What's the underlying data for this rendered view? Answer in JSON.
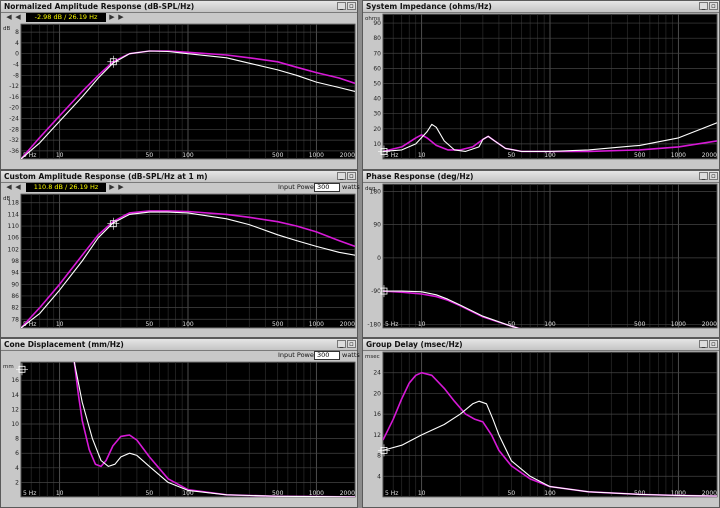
{
  "panels": [
    {
      "title": "Normalized Amplitude Response (dB-SPL/Hz)",
      "readout": "-2.98 dB / 26.19 Hz",
      "chart_data": {
        "type": "line",
        "xscale": "log",
        "xlim": [
          5,
          2000
        ],
        "ylim": [
          -39,
          11
        ],
        "yticks": [
          8,
          4,
          0,
          -4,
          -8,
          -12,
          -16,
          -20,
          -24,
          -28,
          -32,
          -36
        ],
        "yunit": "dB",
        "xticks": [
          "5 Hz",
          "10",
          "50",
          "100",
          "500",
          "1000",
          "2000"
        ],
        "cursor": {
          "x": 26.19,
          "y": -2.98
        },
        "series": [
          {
            "color": "#d619d6",
            "x": [
              5,
              7,
              10,
              15,
              20,
              26,
              35,
              50,
              70,
              100,
              200,
              300,
              500,
              700,
              1000,
              1500,
              2000
            ],
            "y": [
              -39,
              -31,
              -23,
              -14,
              -8,
              -3,
              0,
              1,
              1,
              0.5,
              -0.5,
              -1.5,
              -3,
              -5,
              -7,
              -9,
              -11
            ]
          },
          {
            "color": "#ffffff",
            "x": [
              5,
              7,
              10,
              15,
              20,
              26,
              35,
              50,
              70,
              100,
              200,
              300,
              500,
              700,
              1000,
              1500,
              2000
            ],
            "y": [
              -39,
              -33,
              -25,
              -16,
              -9,
              -3.5,
              0,
              1,
              0.8,
              0,
              -1.5,
              -3.5,
              -6,
              -8,
              -10.5,
              -12.5,
              -14
            ]
          }
        ]
      }
    },
    {
      "title": "System Impedance (ohms/Hz)",
      "chart_data": {
        "type": "line",
        "xscale": "log",
        "xlim": [
          5,
          2000
        ],
        "ylim": [
          0,
          96
        ],
        "yticks": [
          90,
          80,
          70,
          60,
          50,
          40,
          30,
          20,
          10
        ],
        "yunit": "ohms",
        "xticks": [
          "5 Hz",
          "10",
          "50",
          "100",
          "500",
          "1000",
          "2000"
        ],
        "cursor": {
          "x": 5,
          "y": 5
        },
        "series": [
          {
            "color": "#d619d6",
            "x": [
              5,
              7,
              9,
              10,
              11,
              13,
              16,
              20,
              25,
              30,
              33,
              37,
              45,
              60,
              100,
              200,
              500,
              1000,
              2000
            ],
            "y": [
              5,
              8,
              14,
              16,
              14,
              9,
              6,
              6,
              8,
              13,
              15,
              12,
              7,
              5,
              5,
              5,
              6,
              8,
              12
            ]
          },
          {
            "color": "#ffffff",
            "x": [
              5,
              7,
              9,
              11,
              12,
              13,
              15,
              18,
              22,
              28,
              30,
              33,
              37,
              45,
              60,
              100,
              200,
              500,
              1000,
              2000
            ],
            "y": [
              5,
              6,
              10,
              18,
              23,
              21,
              12,
              6,
              5,
              8,
              13,
              15,
              12,
              7,
              5,
              5,
              6,
              9,
              14,
              24
            ]
          }
        ]
      }
    },
    {
      "title": "Custom Amplitude Response (dB-SPL/Hz at 1 m)",
      "readout": "110.8 dB / 26.19 Hz",
      "input_power_label": "Input Power:",
      "input_power_value": "300",
      "input_power_unit": "watts",
      "chart_data": {
        "type": "line",
        "xscale": "log",
        "xlim": [
          5,
          2000
        ],
        "ylim": [
          75,
          121
        ],
        "yticks": [
          118,
          114,
          110,
          106,
          102,
          98,
          94,
          90,
          86,
          82,
          78
        ],
        "yunit": "dB",
        "xticks": [
          "5 Hz",
          "10",
          "50",
          "100",
          "500",
          "1000",
          "2000"
        ],
        "cursor": {
          "x": 26.19,
          "y": 110.8
        },
        "series": [
          {
            "color": "#d619d6",
            "x": [
              5,
              7,
              10,
              15,
              20,
              26,
              35,
              50,
              70,
              100,
              200,
              300,
              500,
              700,
              1000,
              1500,
              2000
            ],
            "y": [
              75,
              82,
              90,
              100,
              107,
              111.5,
              114.5,
              115.2,
              115.2,
              115,
              114,
              113,
              111.5,
              110,
              108,
              105,
              103
            ]
          },
          {
            "color": "#ffffff",
            "x": [
              5,
              7,
              10,
              15,
              20,
              26,
              35,
              50,
              70,
              100,
              200,
              300,
              500,
              700,
              1000,
              1500,
              2000
            ],
            "y": [
              75,
              80,
              88,
              98,
              106,
              111,
              114,
              114.8,
              114.8,
              114.5,
              112.5,
              110.5,
              107,
              105,
              103,
              101,
              100
            ]
          }
        ]
      }
    },
    {
      "title": "Phase Response (deg/Hz)",
      "chart_data": {
        "type": "line",
        "xscale": "log",
        "xlim": [
          5,
          2000
        ],
        "ylim": [
          -190,
          200
        ],
        "yticks": [
          180,
          90,
          0,
          -90,
          -180
        ],
        "ytick_labels": [
          "180",
          "90",
          "0",
          "-90",
          "-180"
        ],
        "yunit": "deg",
        "xticks": [
          "5 Hz",
          "10",
          "50",
          "100",
          "500",
          "1000",
          "2000"
        ],
        "cursor": {
          "x": 5,
          "y": -90
        },
        "series": [
          {
            "color": "#d619d6",
            "x": [
              5,
              7,
              10,
              13,
              16,
              20,
              30,
              50,
              70,
              100,
              200,
              500,
              1000,
              2000
            ],
            "y": [
              -90,
              -93,
              -98,
              -105,
              -115,
              -130,
              -160,
              -185,
              -200,
              -212,
              -230,
              -248,
              -258,
              -265
            ]
          },
          {
            "color": "#ffffff",
            "x": [
              5,
              7,
              10,
              13,
              16,
              20,
              30,
              50,
              70,
              100,
              200,
              500,
              1000,
              2000
            ],
            "y": [
              -90,
              -90,
              -92,
              -100,
              -112,
              -128,
              -158,
              -185,
              -200,
              -212,
              -235,
              -255,
              -265,
              -272
            ]
          }
        ]
      }
    },
    {
      "title": "Cone Displacement (mm/Hz)",
      "input_power_label": "Input Power:",
      "input_power_value": "300",
      "input_power_unit": "watts",
      "chart_data": {
        "type": "line",
        "xscale": "log",
        "xlim": [
          5,
          2000
        ],
        "ylim": [
          0,
          18.5
        ],
        "yticks": [
          16,
          14,
          12,
          10,
          8,
          6,
          4,
          2
        ],
        "yunit": "mm",
        "xticks": [
          "5 Hz",
          "10",
          "50",
          "100",
          "500",
          "1000",
          "2000"
        ],
        "cursor": {
          "x": 5,
          "y": 17.5
        },
        "series": [
          {
            "color": "#d619d6",
            "x": [
              13,
              14,
              15,
              17,
              19,
              21,
              23,
              26,
              30,
              35,
              40,
              50,
              70,
              100,
              200,
              500,
              1000,
              2000
            ],
            "y": [
              18.5,
              14,
              10.5,
              6.5,
              4.5,
              4.2,
              5,
              7,
              8.3,
              8.5,
              7.8,
              5.5,
              2.5,
              1,
              0.3,
              0.1,
              0.05,
              0.02
            ]
          },
          {
            "color": "#ffffff",
            "x": [
              13,
              15,
              18,
              21,
              24,
              27,
              30,
              35,
              40,
              50,
              70,
              100,
              200,
              500,
              1000,
              2000
            ],
            "y": [
              18.5,
              13,
              8,
              5,
              4.2,
              4.5,
              5.5,
              6,
              5.7,
              4.2,
              2,
              0.9,
              0.3,
              0.1,
              0.05,
              0.02
            ]
          }
        ]
      }
    },
    {
      "title": "Group Delay (msec/Hz)",
      "chart_data": {
        "type": "line",
        "xscale": "log",
        "xlim": [
          5,
          2000
        ],
        "ylim": [
          0,
          28
        ],
        "yticks": [
          24,
          20,
          16,
          12,
          8,
          4
        ],
        "yunit": "msec",
        "xticks": [
          "5 Hz",
          "10",
          "50",
          "100",
          "500",
          "1000",
          "2000"
        ],
        "cursor": {
          "x": 5,
          "y": 9
        },
        "series": [
          {
            "color": "#d619d6",
            "x": [
              5,
              6,
              7,
              8,
              9,
              10,
              12,
              15,
              18,
              22,
              26,
              30,
              35,
              40,
              50,
              70,
              100,
              200,
              500,
              1000,
              2000
            ],
            "y": [
              11,
              15,
              19,
              22,
              23.5,
              24,
              23.5,
              21,
              18.5,
              16,
              15,
              14.5,
              12,
              9,
              6,
              3.5,
              2,
              1,
              0.5,
              0.3,
              0.2
            ]
          },
          {
            "color": "#ffffff",
            "x": [
              5,
              7,
              10,
              15,
              20,
              25,
              28,
              32,
              36,
              40,
              50,
              70,
              100,
              200,
              500,
              1000,
              2000
            ],
            "y": [
              9,
              10,
              12,
              14,
              16,
              18,
              18.5,
              18,
              15,
              12,
              7,
              4,
              2,
              1,
              0.5,
              0.3,
              0.2
            ]
          }
        ]
      }
    }
  ],
  "window_buttons": {
    "minimize": "_",
    "maximize": "▫"
  },
  "nav_buttons": {
    "left": "◀",
    "right": "▶"
  }
}
